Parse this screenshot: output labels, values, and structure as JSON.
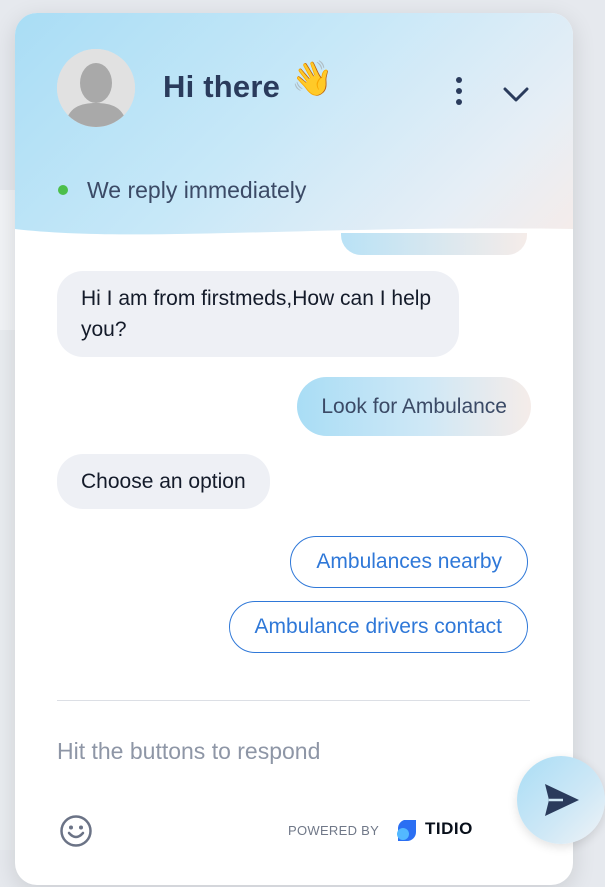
{
  "header": {
    "title": "Hi there",
    "wave_emoji": "👋",
    "status": "We reply immediately",
    "status_color": "#4cbf4a",
    "menu_icon": "more-vertical-icon",
    "minimize_icon": "chevron-down-icon",
    "avatar_icon": "user-avatar-icon"
  },
  "messages": [
    {
      "from": "bot",
      "text": "Hi I am from firstmeds,How can I help you?"
    },
    {
      "from": "user",
      "text": "Look for Ambulance"
    },
    {
      "from": "bot",
      "text": "Choose an option"
    }
  ],
  "options": [
    {
      "label": "Ambulances nearby"
    },
    {
      "label": "Ambulance drivers contact"
    }
  ],
  "composer": {
    "placeholder": "Hit the buttons to respond",
    "emoji_icon": "smiley-icon",
    "send_icon": "send-icon"
  },
  "footer": {
    "powered_by": "POWERED BY",
    "brand": "TIDIO",
    "brand_icon": "tidio-logo-icon"
  },
  "colors": {
    "accent": "#2f78d8",
    "title": "#2a3b5c"
  }
}
